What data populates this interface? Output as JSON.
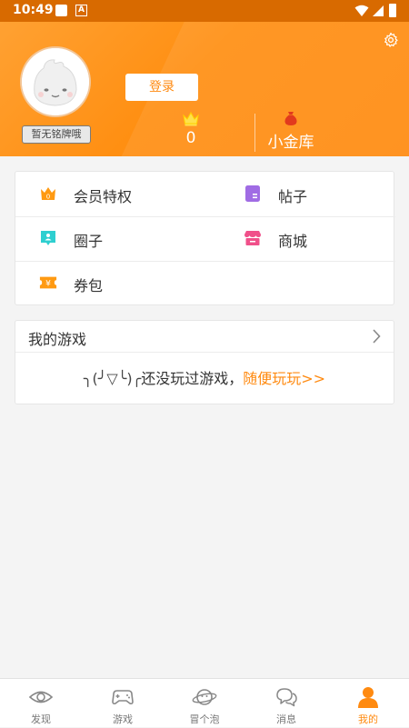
{
  "status_bar": {
    "time": "10:49",
    "notification_letter": "A"
  },
  "header": {
    "login_label": "登录",
    "badge_label": "暂无铭牌哦",
    "level_value": "0",
    "gold_label": "小金库"
  },
  "menu": {
    "items": [
      {
        "label": "会员特权",
        "icon": "crown-icon"
      },
      {
        "label": "帖子",
        "icon": "post-icon"
      },
      {
        "label": "圈子",
        "icon": "circle-icon"
      },
      {
        "label": "商城",
        "icon": "store-icon"
      },
      {
        "label": "券包",
        "icon": "coupon-icon"
      }
    ]
  },
  "games": {
    "title": "我的游戏",
    "empty_kaomoji": "╮(╯▽╰)╭",
    "empty_text": "还没玩过游戏，",
    "empty_link": "随便玩玩>>"
  },
  "tabbar": {
    "tabs": [
      {
        "label": "发现",
        "icon": "eye-icon"
      },
      {
        "label": "游戏",
        "icon": "gamepad-icon"
      },
      {
        "label": "冒个泡",
        "icon": "planet-icon"
      },
      {
        "label": "消息",
        "icon": "chat-icon"
      },
      {
        "label": "我的",
        "icon": "user-icon"
      }
    ],
    "active_tab": "我的"
  },
  "colors": {
    "accent": "#ff8a10",
    "status_bar": "#d86a00",
    "post_icon": "#a06ce4",
    "circle_icon": "#2ecfd0",
    "store_icon": "#f0508a"
  }
}
